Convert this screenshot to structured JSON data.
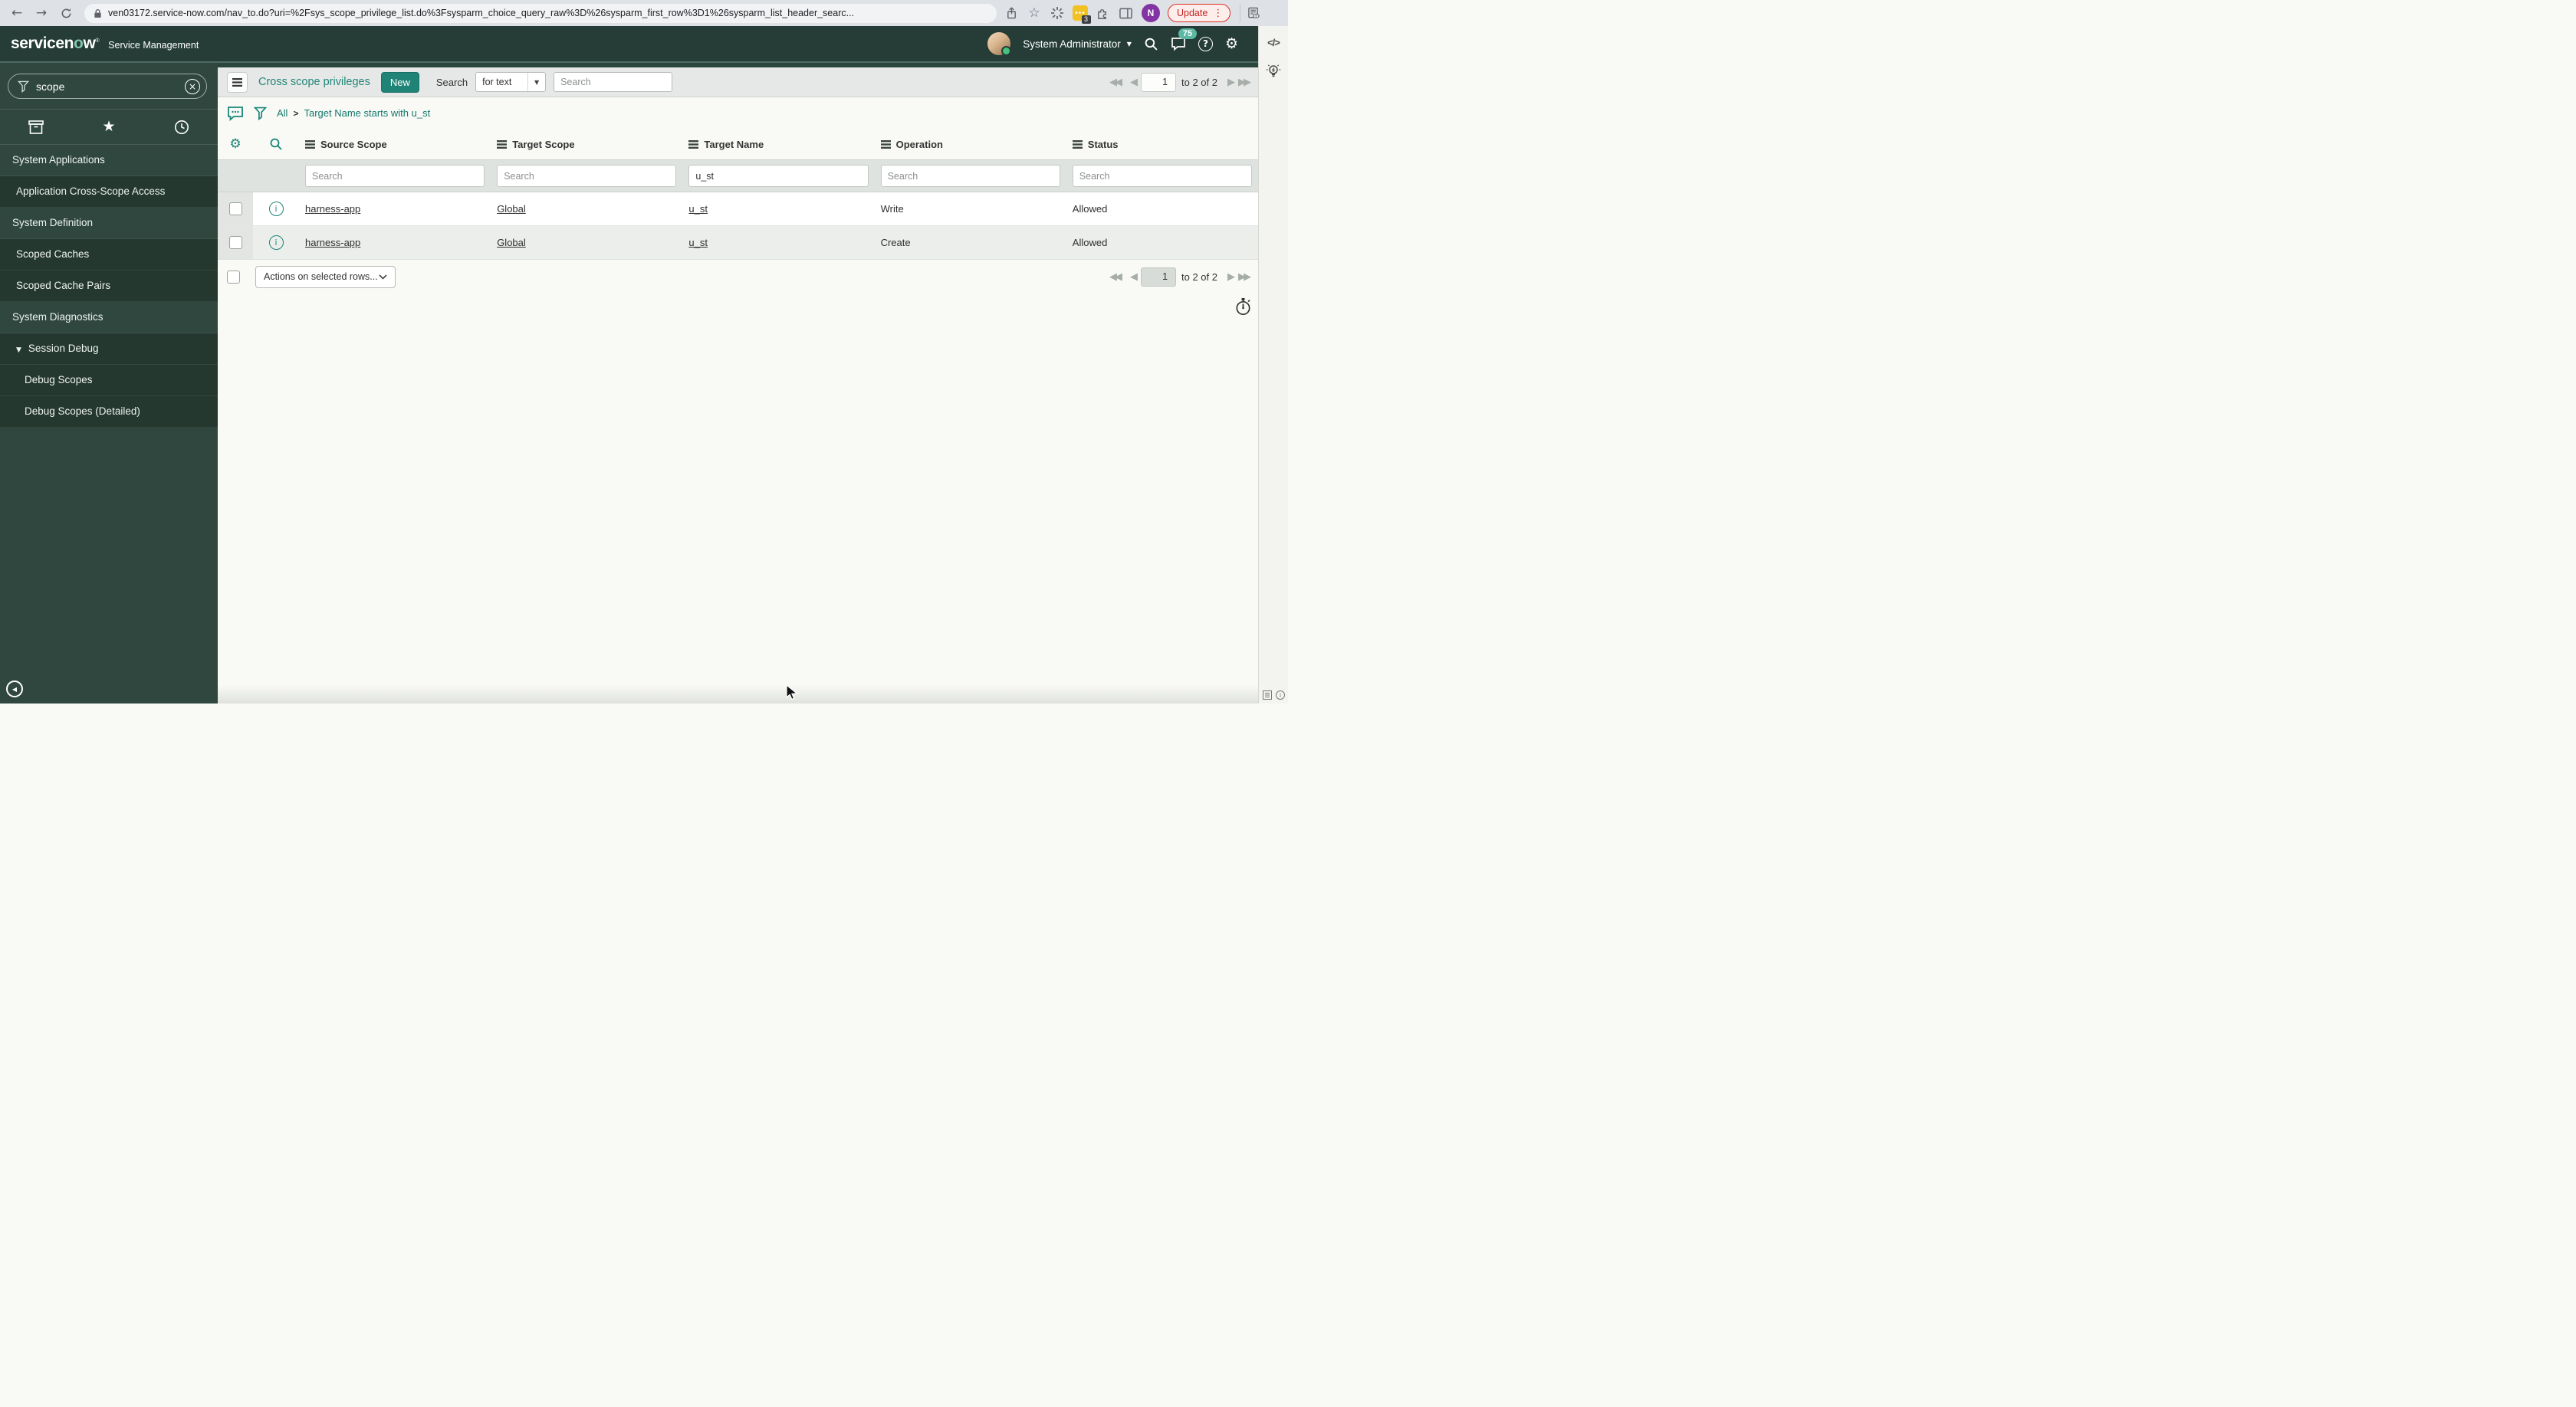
{
  "browser": {
    "url": "ven03172.service-now.com/nav_to.do?uri=%2Fsys_scope_privilege_list.do%3Fsysparm_choice_query_raw%3D%26sysparm_first_row%3D1%26sysparm_list_header_searc...",
    "update_label": "Update",
    "extension_badge": "3",
    "profile_initial": "N"
  },
  "banner": {
    "logo_prefix": "servicen",
    "logo_o": "o",
    "logo_suffix": "w",
    "product": "Service Management",
    "user_name": "System Administrator",
    "notification_count": "75"
  },
  "sidebar": {
    "filter_value": "scope",
    "items": [
      {
        "label": "System Applications"
      },
      {
        "label": "Application Cross-Scope Access"
      },
      {
        "label": "System Definition"
      },
      {
        "label": "Scoped Caches"
      },
      {
        "label": "Scoped Cache Pairs"
      },
      {
        "label": "System Diagnostics"
      },
      {
        "label": "Session Debug"
      },
      {
        "label": "Debug Scopes"
      },
      {
        "label": "Debug Scopes (Detailed)"
      }
    ]
  },
  "list": {
    "title": "Cross scope privileges",
    "new_button": "New",
    "search_label": "Search",
    "search_type": "for text",
    "search_placeholder": "Search",
    "breadcrumb": {
      "root": "All",
      "separator": ">",
      "condition": "Target Name starts with u_st"
    },
    "columns": [
      "Source Scope",
      "Target Scope",
      "Target Name",
      "Operation",
      "Status"
    ],
    "filters": [
      {
        "placeholder": "Search",
        "value": ""
      },
      {
        "placeholder": "Search",
        "value": ""
      },
      {
        "placeholder": "Search",
        "value": "u_st"
      },
      {
        "placeholder": "Search",
        "value": ""
      },
      {
        "placeholder": "Search",
        "value": ""
      }
    ],
    "rows": [
      {
        "source_scope": "harness-app",
        "target_scope": "Global",
        "target_name": "u_st",
        "operation": "Write",
        "status": "Allowed"
      },
      {
        "source_scope": "harness-app",
        "target_scope": "Global",
        "target_name": "u_st",
        "operation": "Create",
        "status": "Allowed"
      }
    ],
    "actions_placeholder": "Actions on selected rows...",
    "pagination": {
      "page": "1",
      "range": "to 2 of 2"
    }
  },
  "icons": {
    "caret_down": "▼",
    "star_filled": "★",
    "star_outline": "☆",
    "gear": "⚙",
    "first": "◀◀",
    "prev": "◀",
    "next": "▶",
    "last": "▶▶",
    "menu_dots": "⋮",
    "clear": "×",
    "code": "</>",
    "question": "?",
    "info": "i",
    "collapse": "◀",
    "back": "←",
    "forward": "→"
  },
  "colors": {
    "accent_teal": "#1f8476",
    "banner_bg": "#253d36",
    "badge_teal": "#5cb8a2",
    "update_red": "#c5221f"
  }
}
